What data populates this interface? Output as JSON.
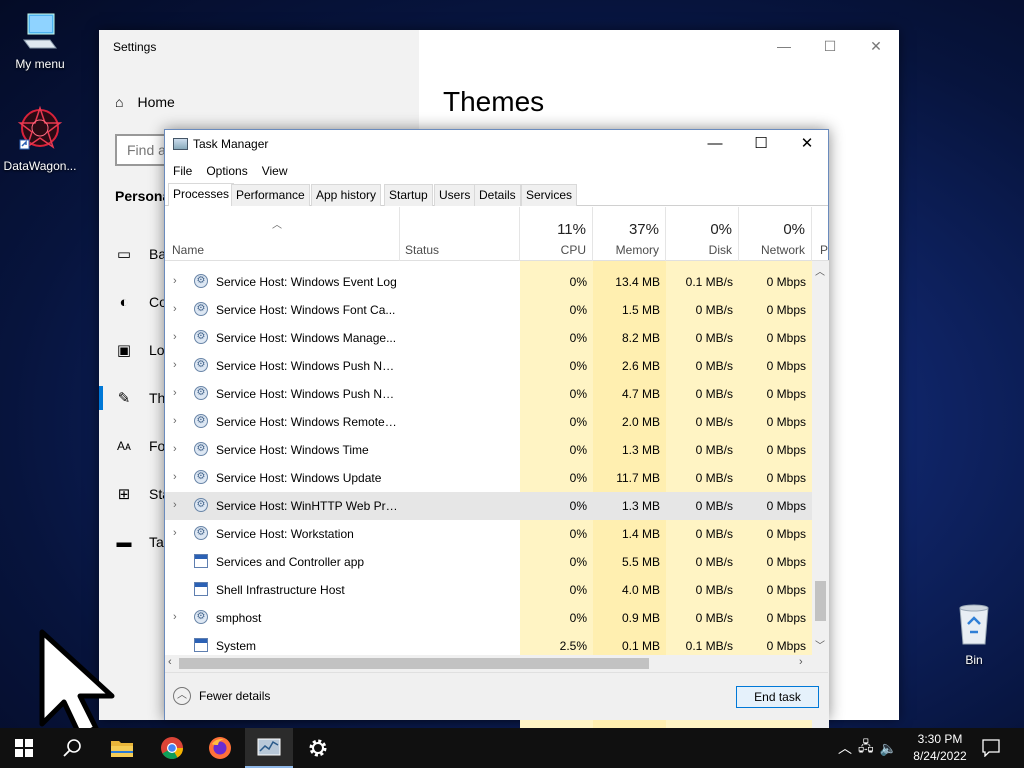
{
  "desktop": {
    "icons": [
      {
        "label": "My menu",
        "icon": "computer-icon"
      },
      {
        "label": "DataWagon...",
        "icon": "datawagon-logo-icon"
      },
      {
        "label": "Bin",
        "icon": "recycle-bin-icon"
      }
    ]
  },
  "settings": {
    "window_title": "Settings",
    "home_label": "Home",
    "search_placeholder": "Find a",
    "section_label": "Persona",
    "nav_items": [
      {
        "label": "Bac",
        "icon": "picture-icon"
      },
      {
        "label": "Co",
        "icon": "palette-icon"
      },
      {
        "label": "Loc",
        "icon": "lock-screen-icon"
      },
      {
        "label": "The",
        "icon": "themes-icon"
      },
      {
        "label": "Fon",
        "icon": "fonts-icon"
      },
      {
        "label": "Sta",
        "icon": "start-icon"
      },
      {
        "label": "Tas",
        "icon": "taskbar-icon"
      }
    ],
    "page_heading": "Themes"
  },
  "task_manager": {
    "window_title": "Task Manager",
    "menu": [
      "File",
      "Options",
      "View"
    ],
    "tabs": [
      "Processes",
      "Performance",
      "App history",
      "Startup",
      "Users",
      "Details",
      "Services"
    ],
    "active_tab": "Processes",
    "columns": {
      "name": "Name",
      "status": "Status",
      "cpu": {
        "pct": "11%",
        "label": "CPU"
      },
      "memory": {
        "pct": "37%",
        "label": "Memory"
      },
      "disk": {
        "pct": "0%",
        "label": "Disk"
      },
      "network": {
        "pct": "0%",
        "label": "Network"
      },
      "extra": "P"
    },
    "processes": [
      {
        "name": "Service Host: Windows Event Log",
        "cpu": "0%",
        "memory": "13.4 MB",
        "disk": "0.1 MB/s",
        "network": "0 Mbps",
        "expandable": true,
        "icon": "gear"
      },
      {
        "name": "Service Host: Windows Font Ca...",
        "cpu": "0%",
        "memory": "1.5 MB",
        "disk": "0 MB/s",
        "network": "0 Mbps",
        "expandable": true,
        "icon": "gear"
      },
      {
        "name": "Service Host: Windows Manage...",
        "cpu": "0%",
        "memory": "8.2 MB",
        "disk": "0 MB/s",
        "network": "0 Mbps",
        "expandable": true,
        "icon": "gear"
      },
      {
        "name": "Service Host: Windows Push No...",
        "cpu": "0%",
        "memory": "2.6 MB",
        "disk": "0 MB/s",
        "network": "0 Mbps",
        "expandable": true,
        "icon": "gear"
      },
      {
        "name": "Service Host: Windows Push No...",
        "cpu": "0%",
        "memory": "4.7 MB",
        "disk": "0 MB/s",
        "network": "0 Mbps",
        "expandable": true,
        "icon": "gear"
      },
      {
        "name": "Service Host: Windows Remote ...",
        "cpu": "0%",
        "memory": "2.0 MB",
        "disk": "0 MB/s",
        "network": "0 Mbps",
        "expandable": true,
        "icon": "gear"
      },
      {
        "name": "Service Host: Windows Time",
        "cpu": "0%",
        "memory": "1.3 MB",
        "disk": "0 MB/s",
        "network": "0 Mbps",
        "expandable": true,
        "icon": "gear"
      },
      {
        "name": "Service Host: Windows Update",
        "cpu": "0%",
        "memory": "11.7 MB",
        "disk": "0 MB/s",
        "network": "0 Mbps",
        "expandable": true,
        "icon": "gear"
      },
      {
        "name": "Service Host: WinHTTP Web Pro...",
        "cpu": "0%",
        "memory": "1.3 MB",
        "disk": "0 MB/s",
        "network": "0 Mbps",
        "expandable": true,
        "icon": "gear",
        "highlighted": true
      },
      {
        "name": "Service Host: Workstation",
        "cpu": "0%",
        "memory": "1.4 MB",
        "disk": "0 MB/s",
        "network": "0 Mbps",
        "expandable": true,
        "icon": "gear"
      },
      {
        "name": "Services and Controller app",
        "cpu": "0%",
        "memory": "5.5 MB",
        "disk": "0 MB/s",
        "network": "0 Mbps",
        "expandable": false,
        "icon": "window"
      },
      {
        "name": "Shell Infrastructure Host",
        "cpu": "0%",
        "memory": "4.0 MB",
        "disk": "0 MB/s",
        "network": "0 Mbps",
        "expandable": false,
        "icon": "window"
      },
      {
        "name": "smphost",
        "cpu": "0%",
        "memory": "0.9 MB",
        "disk": "0 MB/s",
        "network": "0 Mbps",
        "expandable": true,
        "icon": "gear"
      },
      {
        "name": "System",
        "cpu": "2.5%",
        "memory": "0.1 MB",
        "disk": "0.1 MB/s",
        "network": "0 Mbps",
        "expandable": false,
        "icon": "window"
      }
    ],
    "fewer_details_label": "Fewer details",
    "end_task_label": "End task"
  },
  "taskbar": {
    "clock_time": "3:30 PM",
    "clock_date": "8/24/2022"
  }
}
